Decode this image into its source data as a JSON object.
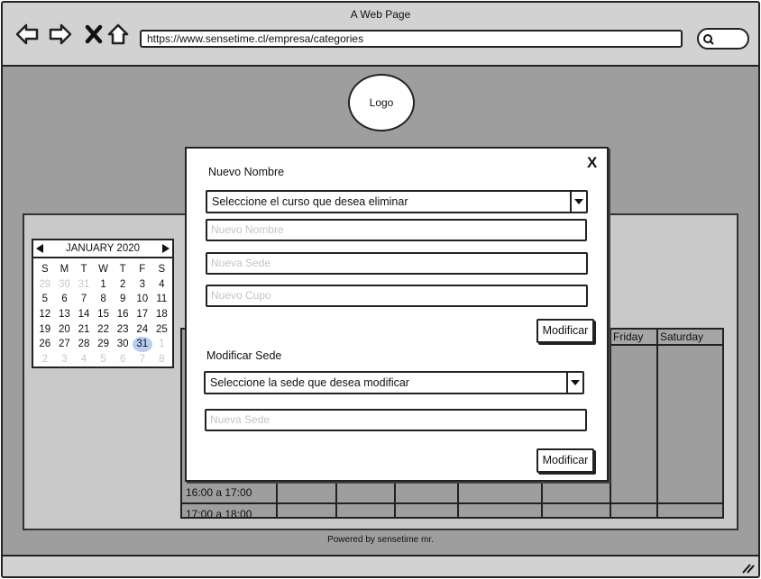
{
  "browser": {
    "title": "A Web Page",
    "url": "https://www.sensetime.cl/empresa/categories"
  },
  "page": {
    "logo": "Logo",
    "footer": "Powered by sensetime mr."
  },
  "calendar": {
    "month_label": "JANUARY 2020",
    "weekdays": [
      "S",
      "M",
      "T",
      "W",
      "T",
      "F",
      "S"
    ],
    "days": [
      {
        "d": "29",
        "dim": true
      },
      {
        "d": "30",
        "dim": true
      },
      {
        "d": "31",
        "dim": true
      },
      {
        "d": "1"
      },
      {
        "d": "2"
      },
      {
        "d": "3"
      },
      {
        "d": "4"
      },
      {
        "d": "5"
      },
      {
        "d": "6"
      },
      {
        "d": "7"
      },
      {
        "d": "8"
      },
      {
        "d": "9"
      },
      {
        "d": "10"
      },
      {
        "d": "11"
      },
      {
        "d": "12"
      },
      {
        "d": "13"
      },
      {
        "d": "14"
      },
      {
        "d": "15"
      },
      {
        "d": "16"
      },
      {
        "d": "17"
      },
      {
        "d": "18"
      },
      {
        "d": "19"
      },
      {
        "d": "20"
      },
      {
        "d": "21"
      },
      {
        "d": "22"
      },
      {
        "d": "23"
      },
      {
        "d": "24"
      },
      {
        "d": "25"
      },
      {
        "d": "26"
      },
      {
        "d": "27"
      },
      {
        "d": "28"
      },
      {
        "d": "29"
      },
      {
        "d": "30"
      },
      {
        "d": "31",
        "selected": true
      },
      {
        "d": "1",
        "dim": true
      },
      {
        "d": "2",
        "dim": true
      },
      {
        "d": "3",
        "dim": true
      },
      {
        "d": "4",
        "dim": true
      },
      {
        "d": "5",
        "dim": true
      },
      {
        "d": "6",
        "dim": true
      },
      {
        "d": "7",
        "dim": true
      },
      {
        "d": "8",
        "dim": true
      }
    ]
  },
  "schedule": {
    "day_headers": [
      "Friday",
      "Saturday"
    ],
    "times": [
      "16:00 a 17:00",
      "17:00 a 18:00"
    ]
  },
  "modal": {
    "close_label": "X",
    "section1_label": "Nuevo Nombre",
    "course_select_value": "Seleccione el curso que desea eliminar",
    "name_placeholder": "Nuevo Nombre",
    "sede_placeholder": "Nueva Sede",
    "cupo_placeholder": "Nuevo Cupo",
    "modify_label_1": "Modificar",
    "section2_label": "Modificar Sede",
    "sede_select_value": "Seleccione la sede que desea modificar",
    "sede2_placeholder": "Nueva Sede",
    "modify_label_2": "Modificar"
  }
}
